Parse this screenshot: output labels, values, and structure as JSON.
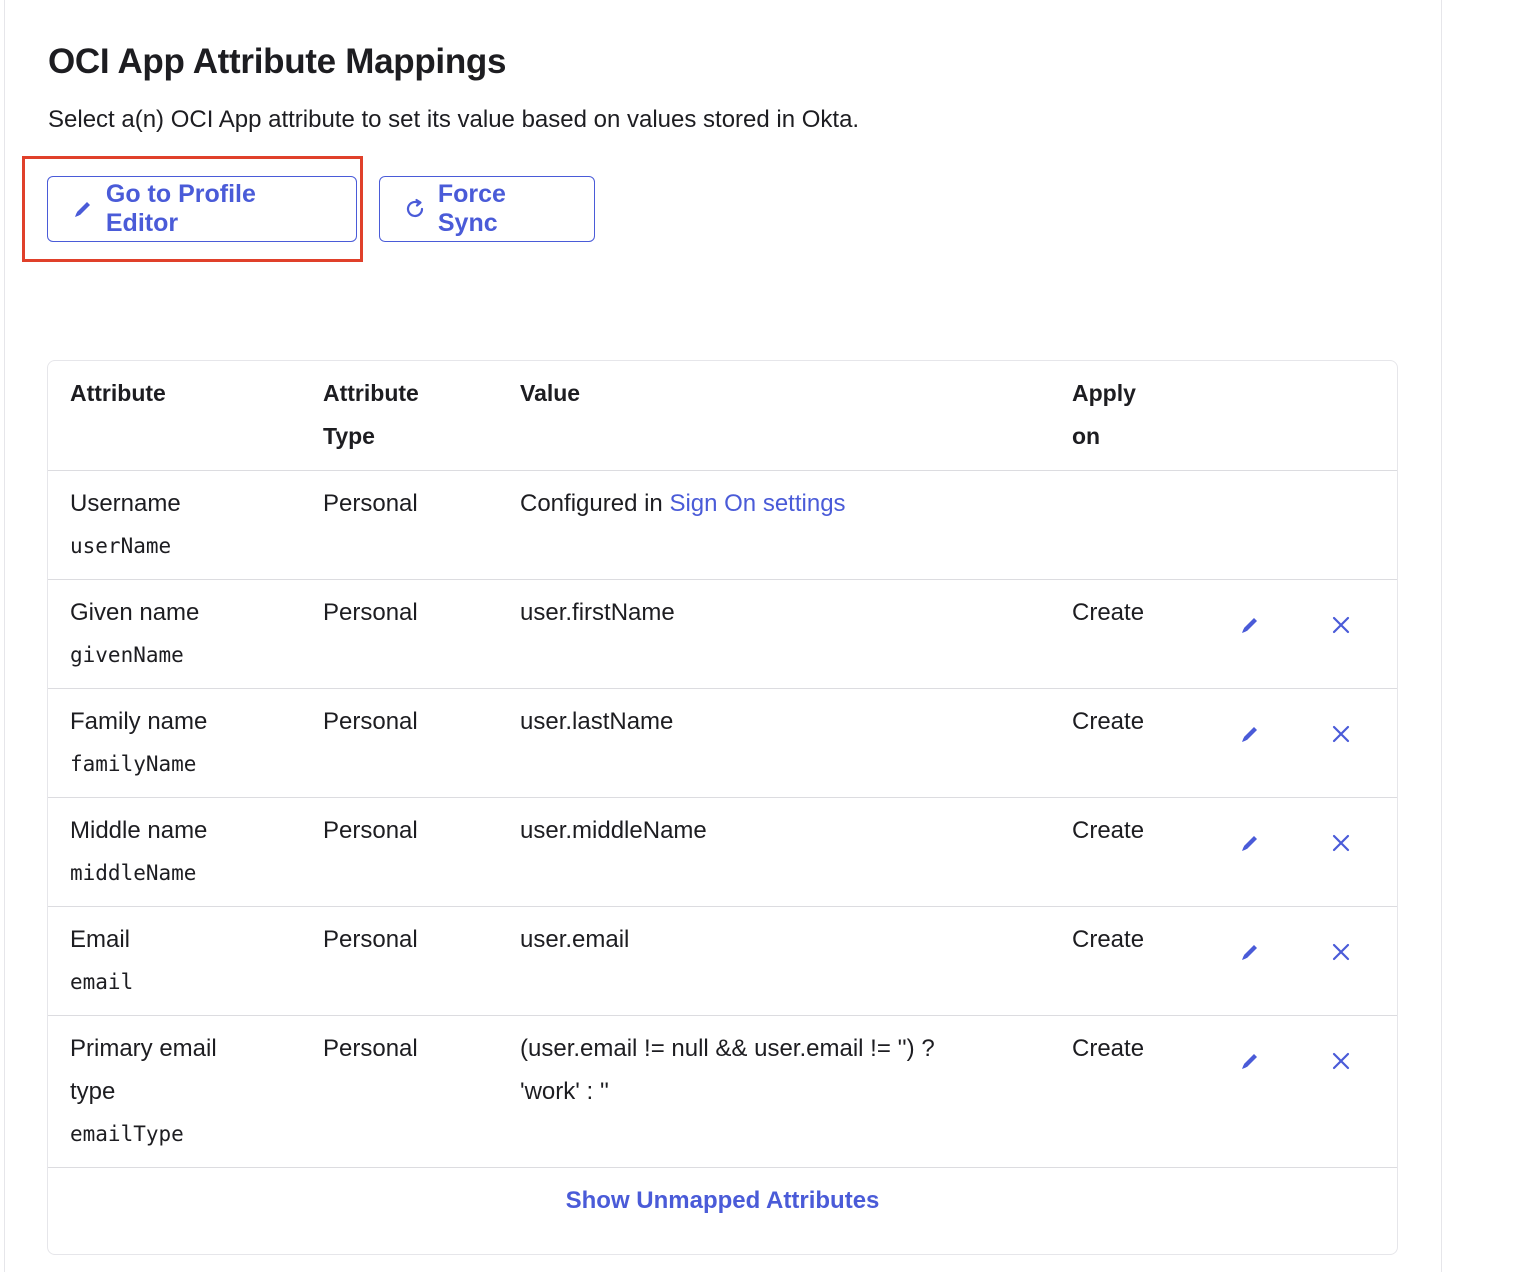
{
  "header": {
    "title": "OCI App Attribute Mappings",
    "subtitle": "Select a(n) OCI App attribute to set its value based on values stored in Okta."
  },
  "actions": {
    "profile_editor_label": "Go to Profile Editor",
    "force_sync_label": "Force Sync"
  },
  "table": {
    "columns": {
      "attribute": "Attribute",
      "attribute_type_1": "Attribute",
      "attribute_type_2": "Type",
      "value": "Value",
      "apply_on_1": "Apply",
      "apply_on_2": "on"
    },
    "rows": [
      {
        "name": "Username",
        "key": "userName",
        "type": "Personal",
        "value_prefix": "Configured in ",
        "value_link": "Sign On settings",
        "apply": ""
      },
      {
        "name": "Given name",
        "key": "givenName",
        "type": "Personal",
        "value": "user.firstName",
        "apply": "Create"
      },
      {
        "name": "Family name",
        "key": "familyName",
        "type": "Personal",
        "value": "user.lastName",
        "apply": "Create"
      },
      {
        "name": "Middle name",
        "key": "middleName",
        "type": "Personal",
        "value": "user.middleName",
        "apply": "Create"
      },
      {
        "name": "Email",
        "key": "email",
        "type": "Personal",
        "value": "user.email",
        "apply": "Create"
      },
      {
        "name_line1": "Primary email",
        "name_line2": "type",
        "key": "emailType",
        "type": "Personal",
        "value_line1": "(user.email != null && user.email != '') ?",
        "value_line2": "'work' : ''",
        "apply": "Create"
      }
    ],
    "show_unmapped_label": "Show Unmapped Attributes"
  },
  "icons": {
    "edit": "pencil-icon",
    "delete": "close-icon",
    "sync": "refresh-icon"
  },
  "colors": {
    "accent": "#4a5bd8",
    "highlight_border": "#e0402a",
    "text": "#1d1d21"
  }
}
